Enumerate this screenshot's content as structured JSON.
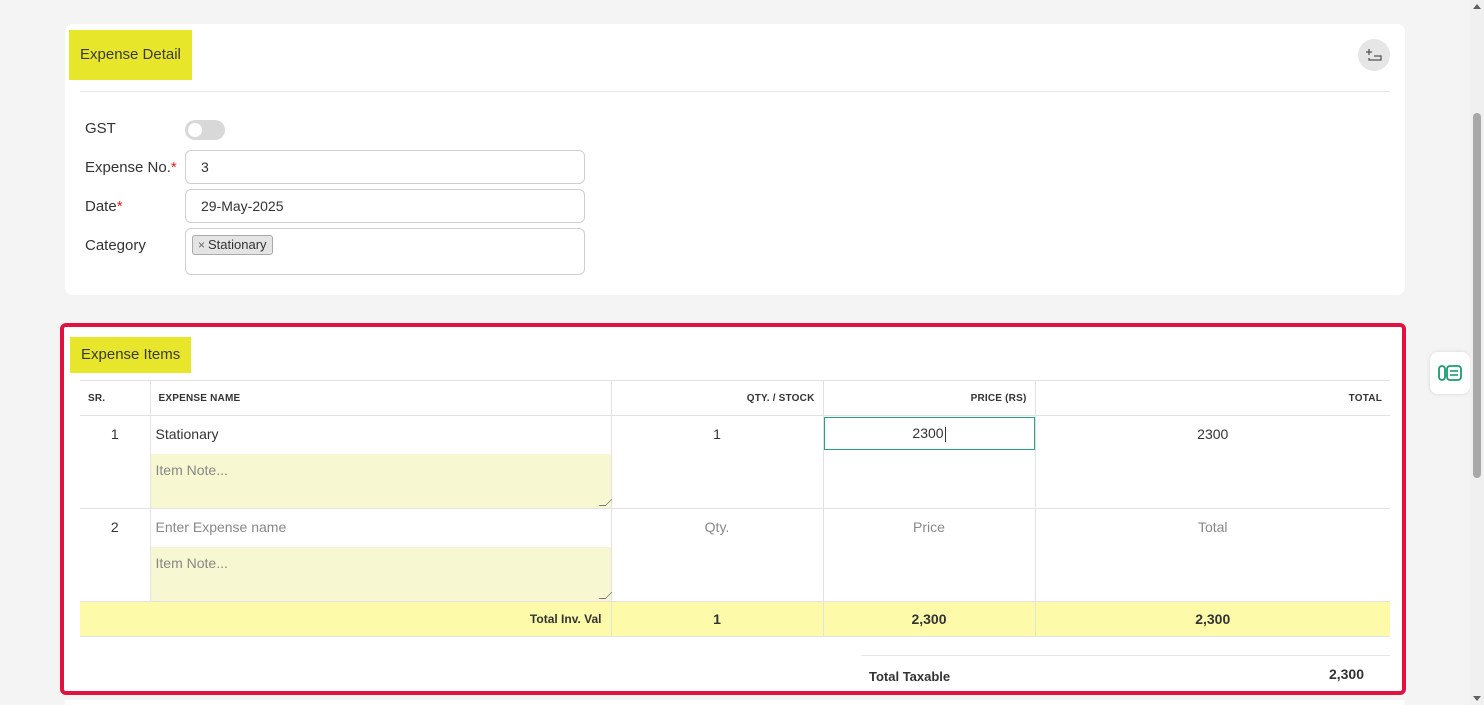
{
  "expense_detail": {
    "title": "Expense Detail",
    "gst_label": "GST",
    "expense_no_label": "Expense No.",
    "expense_no_value": "3",
    "date_label": "Date",
    "date_value": "29-May-2025",
    "category_label": "Category",
    "category_tags": [
      "Stationary"
    ],
    "required_mark": "*",
    "tag_remove": "×"
  },
  "expense_items": {
    "title": "Expense Items",
    "columns": {
      "sr": "SR.",
      "name": "EXPENSE NAME",
      "qty": "QTY. / STOCK",
      "price": "PRICE (RS)",
      "total": "TOTAL"
    },
    "rows": [
      {
        "sr": "1",
        "name": "Stationary",
        "note_placeholder": "Item Note...",
        "qty": "1",
        "price": "2300",
        "total": "2300"
      },
      {
        "sr": "2",
        "name_placeholder": "Enter Expense name",
        "note_placeholder": "Item Note...",
        "qty_placeholder": "Qty.",
        "price_placeholder": "Price",
        "total_placeholder": "Total"
      }
    ],
    "totals": {
      "label": "Total Inv. Val",
      "qty": "1",
      "price": "2,300",
      "total": "2,300"
    },
    "total_taxable_label": "Total Taxable",
    "total_taxable_value": "2,300"
  },
  "colors": {
    "title_highlight": "#e8e62a",
    "section_border": "#e0123e",
    "totals_row": "#fdfbaa",
    "note_bg": "#f7f7d1",
    "active_input_border": "#27a37e",
    "icon_green": "#1a9c6e"
  }
}
